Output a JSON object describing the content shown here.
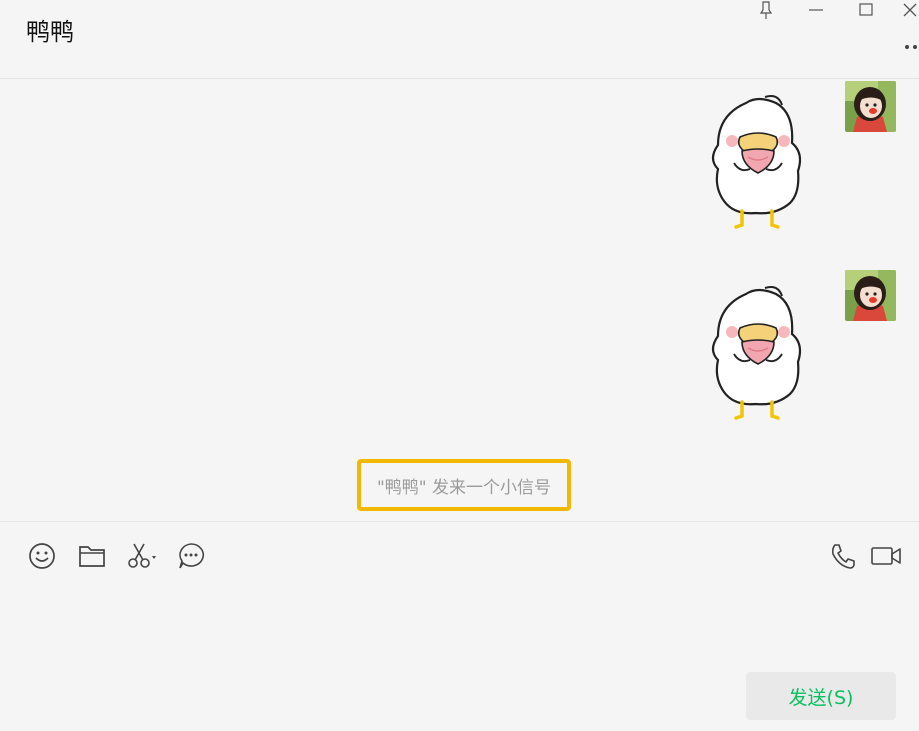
{
  "header": {
    "title": "鸭鸭"
  },
  "window_controls": {
    "pin_icon": "pin-icon",
    "minimize_icon": "minimize-icon",
    "maximize_icon": "maximize-icon",
    "close_icon": "close-icon",
    "more_icon": "more-icon"
  },
  "messages": [
    {
      "type": "sticker",
      "sender": "self",
      "sticker": "white-duckling-holding-heart-sticker",
      "avatar": "user-avatar"
    },
    {
      "type": "sticker",
      "sender": "self",
      "sticker": "white-duckling-holding-heart-sticker",
      "avatar": "user-avatar"
    }
  ],
  "system_notice": {
    "text": "\"鸭鸭\" 发来一个小信号"
  },
  "toolbar": {
    "left_tools": [
      "emoji-icon",
      "folder-icon",
      "scissors-icon",
      "chat-bubble-icon"
    ],
    "right_tools": [
      "phone-icon",
      "video-icon"
    ]
  },
  "input": {
    "value": ""
  },
  "send_button": {
    "label": "发送(S)"
  },
  "colors": {
    "background": "#f5f5f5",
    "notice_border": "#f5b800",
    "send_text": "#07c160",
    "send_bg": "#e9e9e9"
  }
}
